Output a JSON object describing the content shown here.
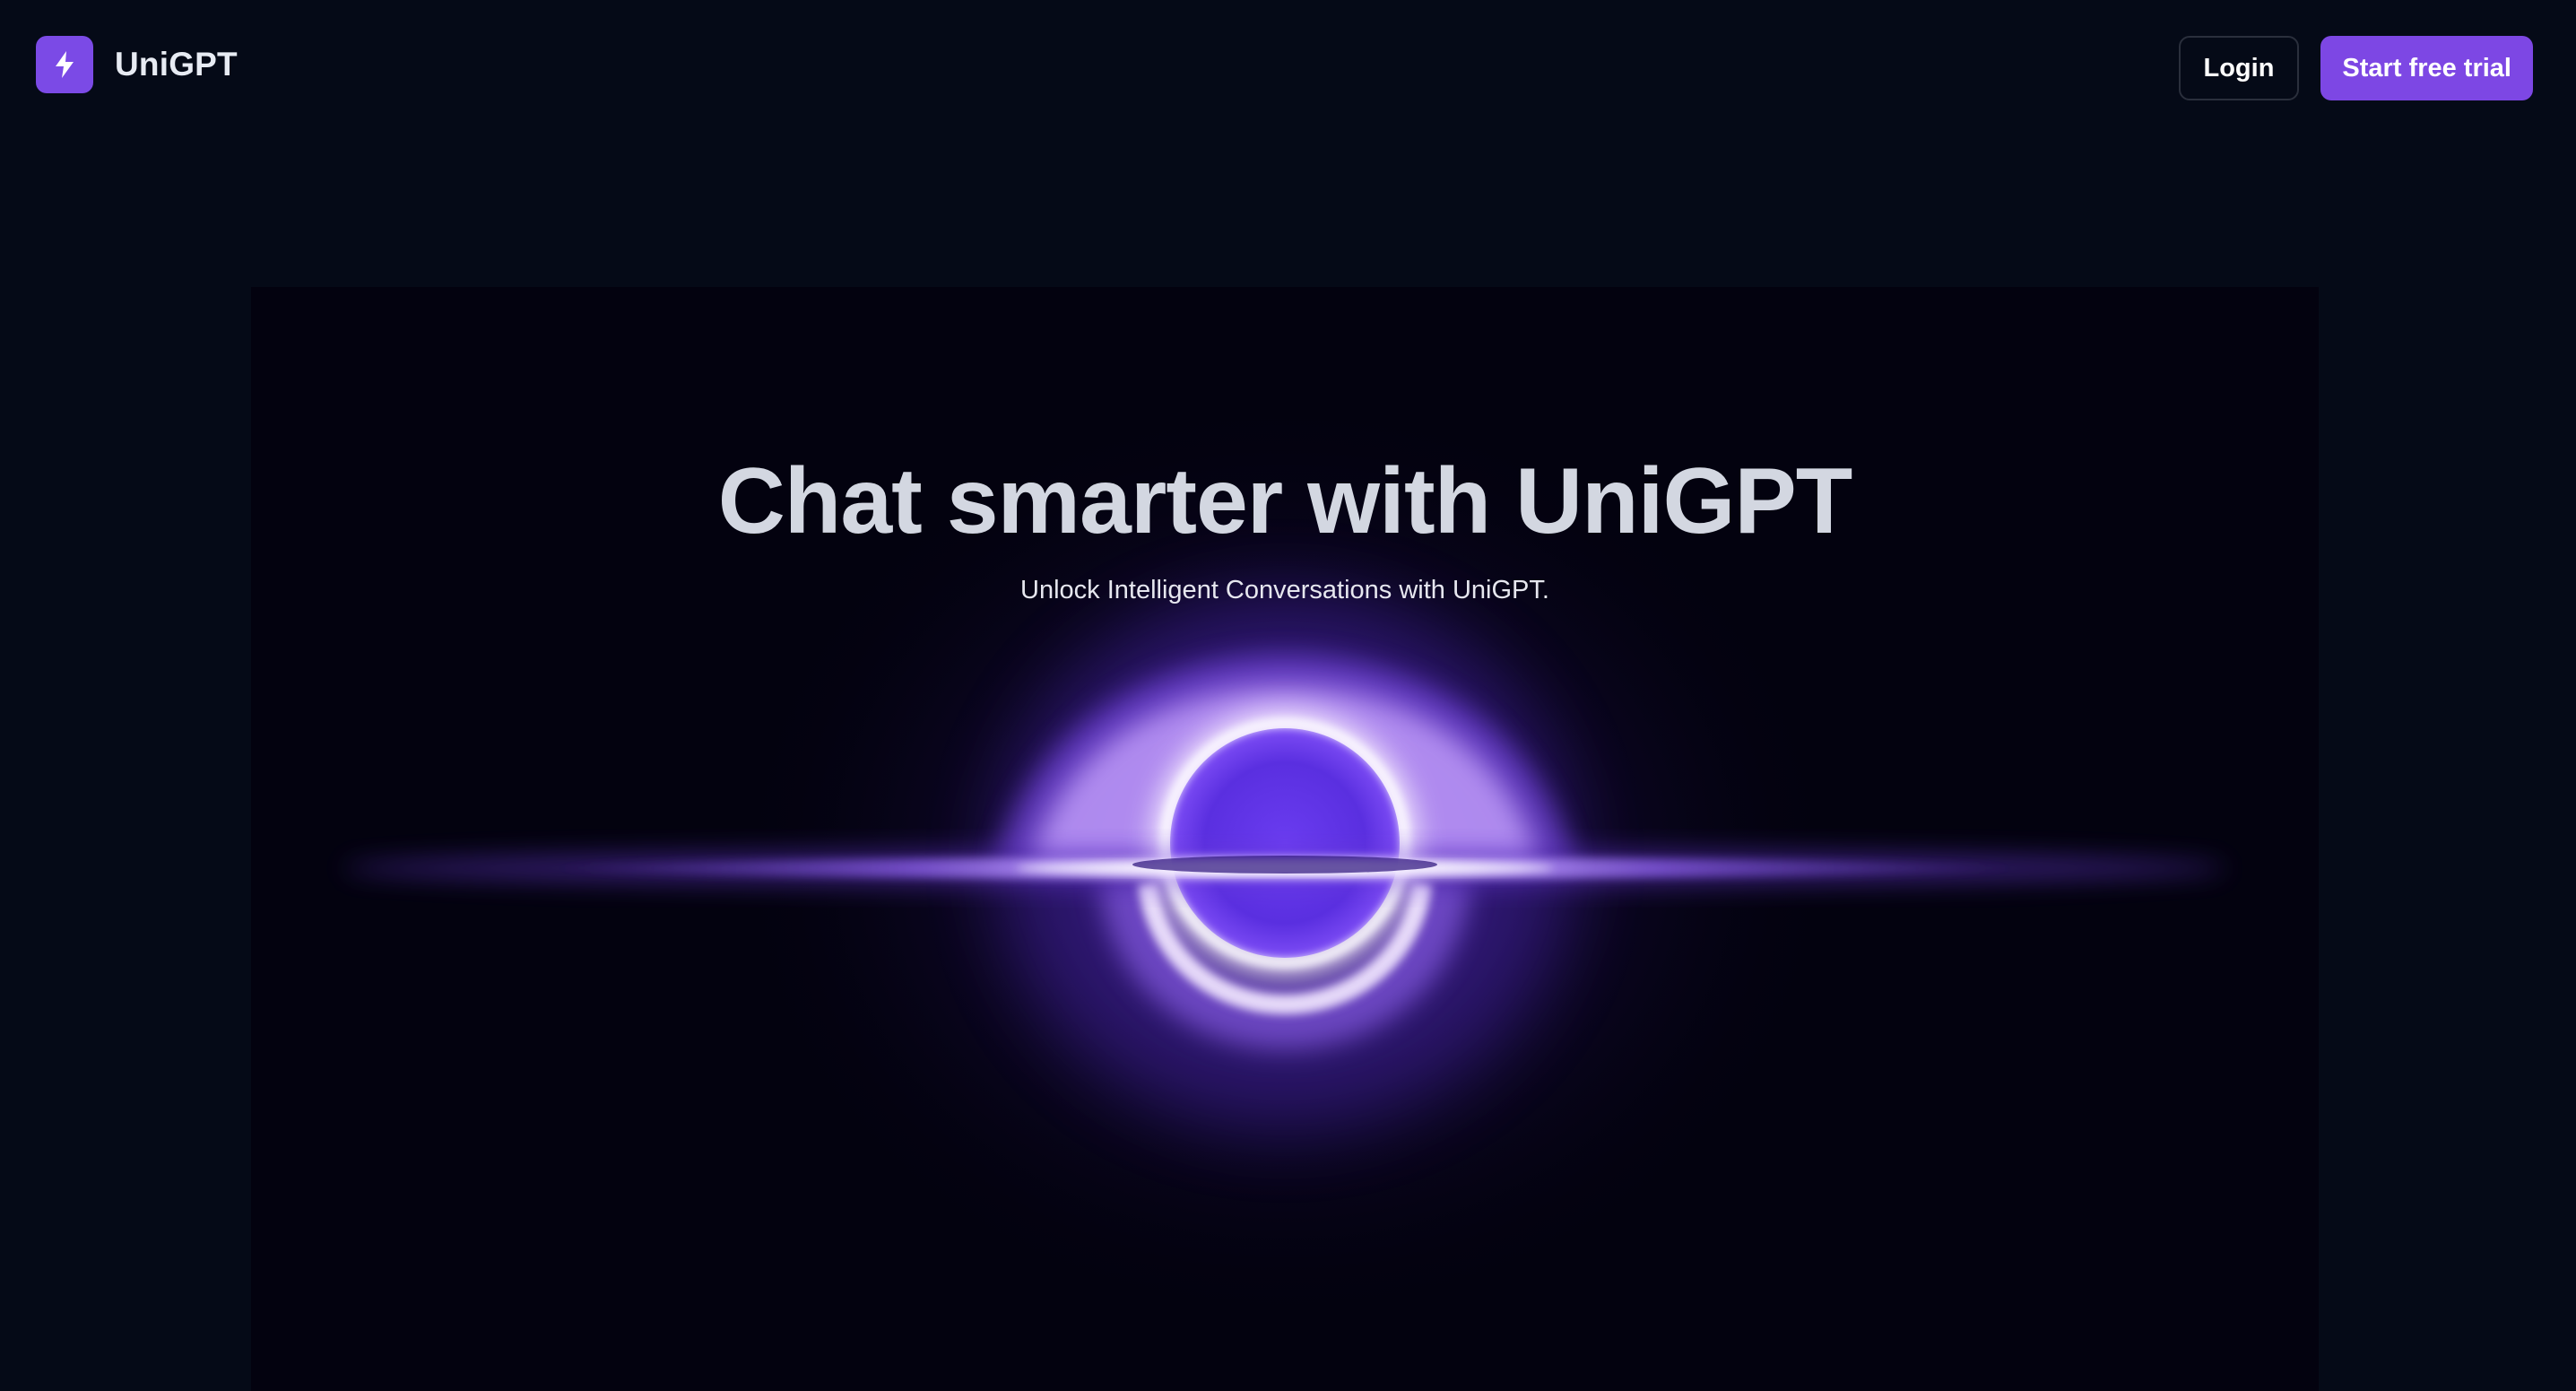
{
  "header": {
    "brand_name": "UniGPT",
    "logo_icon": "lightning-bolt-icon",
    "login_label": "Login",
    "trial_label": "Start free trial"
  },
  "hero": {
    "title": "Chat smarter with UniGPT",
    "subtitle": "Unlock Intelligent Conversations with UniGPT.",
    "art": "black-hole-glow-image"
  },
  "colors": {
    "background": "#050a17",
    "hero_background": "#03020f",
    "accent": "#7d47e4",
    "title_text": "#d3d7e1"
  }
}
